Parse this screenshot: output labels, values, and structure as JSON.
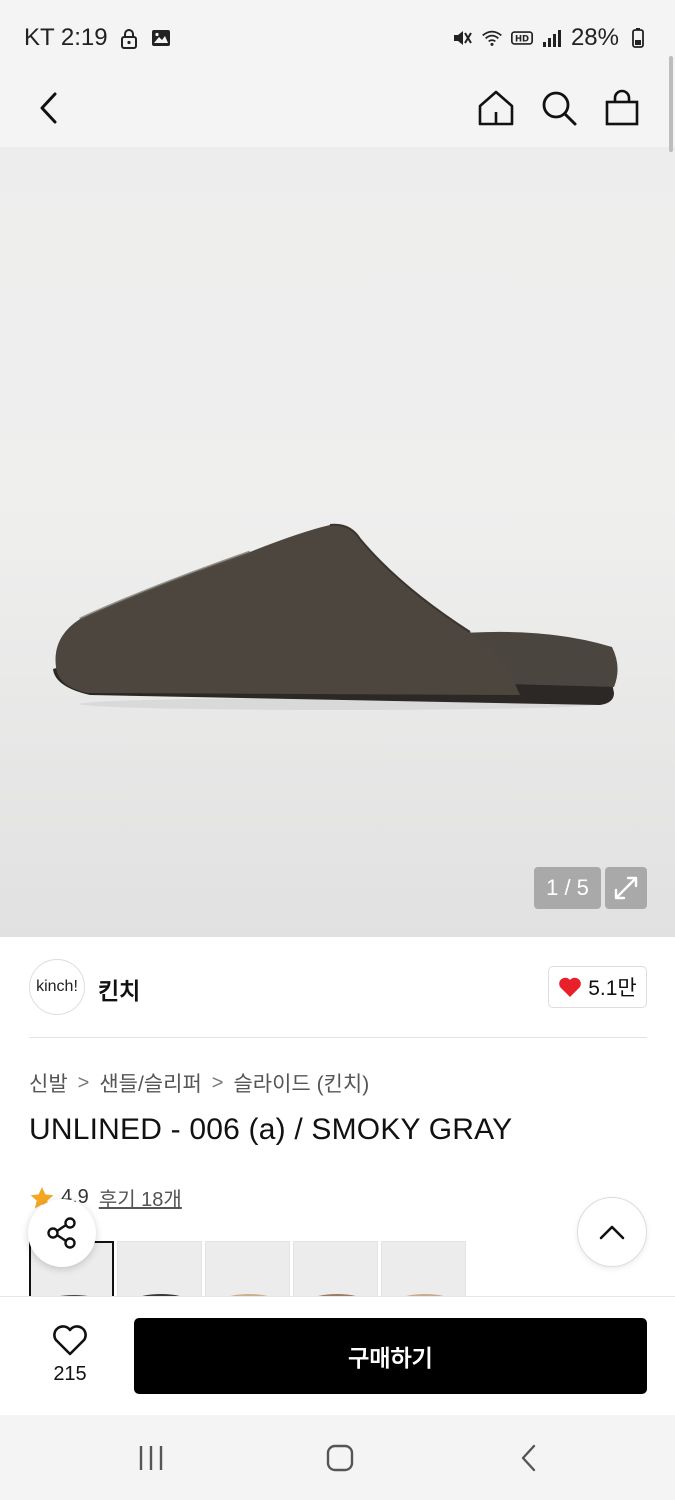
{
  "status_bar": {
    "carrier_time": "KT 2:19",
    "battery": "28%"
  },
  "header": {
    "back_icon": "chevron-left-icon",
    "home_icon": "home-icon",
    "search_icon": "search-icon",
    "cart_icon": "shopping-bag-icon"
  },
  "hero": {
    "image_counter": "1 / 5",
    "expand_icon": "expand-icon"
  },
  "brand": {
    "logo_text": "kinch!",
    "name": "킨치",
    "likes": "5.1만"
  },
  "breadcrumb": {
    "items": [
      "신발",
      "샌들/슬리퍼",
      "슬라이드 (킨치)"
    ],
    "separator": ">"
  },
  "product": {
    "title": "UNLINED - 006 (a) / SMOKY GRAY",
    "rating": "4.9",
    "reviews": "후기 18개"
  },
  "thumbnails": {
    "colors": [
      "#4a453f",
      "#3c3834",
      "#c9b28a",
      "#9a7b63",
      "#c7ab8f"
    ]
  },
  "bottom_bar": {
    "wish_count": "215",
    "buy_label": "구매하기"
  },
  "colors": {
    "accent_heart": "#e8202a",
    "star": "#f5a623",
    "buy_button": "#000000"
  }
}
